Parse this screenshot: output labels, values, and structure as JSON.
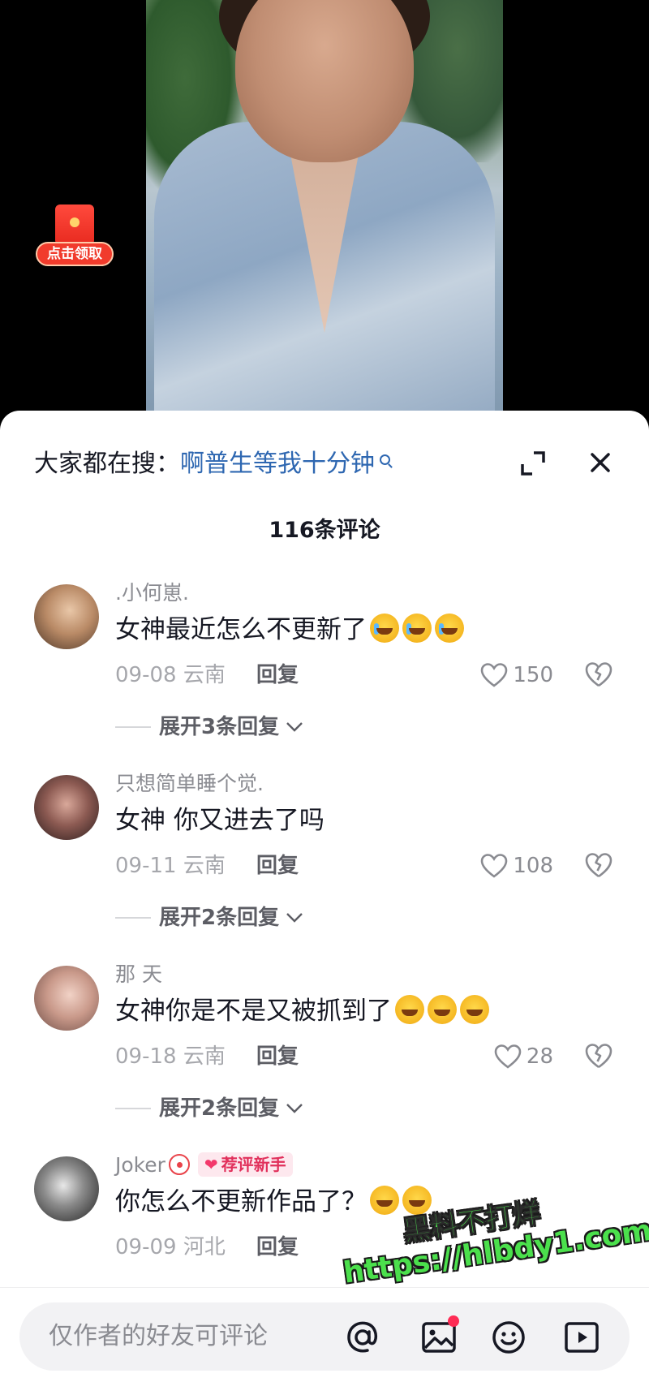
{
  "video": {
    "red_packet_label": "点击领取"
  },
  "sheet": {
    "search_prefix": "大家都在搜：",
    "search_query": "啊普生等我十分钟",
    "comment_count": "116条评论"
  },
  "comments": [
    {
      "username": ".小何崽.",
      "content": "女神最近怎么不更新了",
      "emojis": [
        "crying-face",
        "crying-face",
        "crying-face"
      ],
      "date": "09-08",
      "location": "云南",
      "reply_label": "回复",
      "likes": "150",
      "expand_label": "展开3条回复"
    },
    {
      "username": "只想简单睡个觉.",
      "content": "女神 你又进去了吗",
      "emojis": [],
      "date": "09-11",
      "location": "云南",
      "reply_label": "回复",
      "likes": "108",
      "expand_label": "展开2条回复"
    },
    {
      "username": "那 天",
      "content": "女神你是不是又被抓到了",
      "emojis": [
        "emo-face",
        "emo-face",
        "emo-face"
      ],
      "date": "09-18",
      "location": "云南",
      "reply_label": "回复",
      "likes": "28",
      "expand_label": "展开2条回复"
    },
    {
      "username": "Joker",
      "badge": "荐评新手",
      "content": "你怎么不更新作品了？",
      "emojis": [
        "shocked-face",
        "shocked-face"
      ],
      "date": "09-09",
      "location": "河北",
      "reply_label": "回复"
    }
  ],
  "watermark": {
    "line1": "黑料不打烊",
    "line2": "https://hlbdy1.com"
  },
  "input": {
    "placeholder": "仅作者的好友可评论"
  },
  "colors": {
    "search_query": "#2e67b1",
    "accent_red": "#fe2c55",
    "watermark_green": "#4be04c"
  }
}
